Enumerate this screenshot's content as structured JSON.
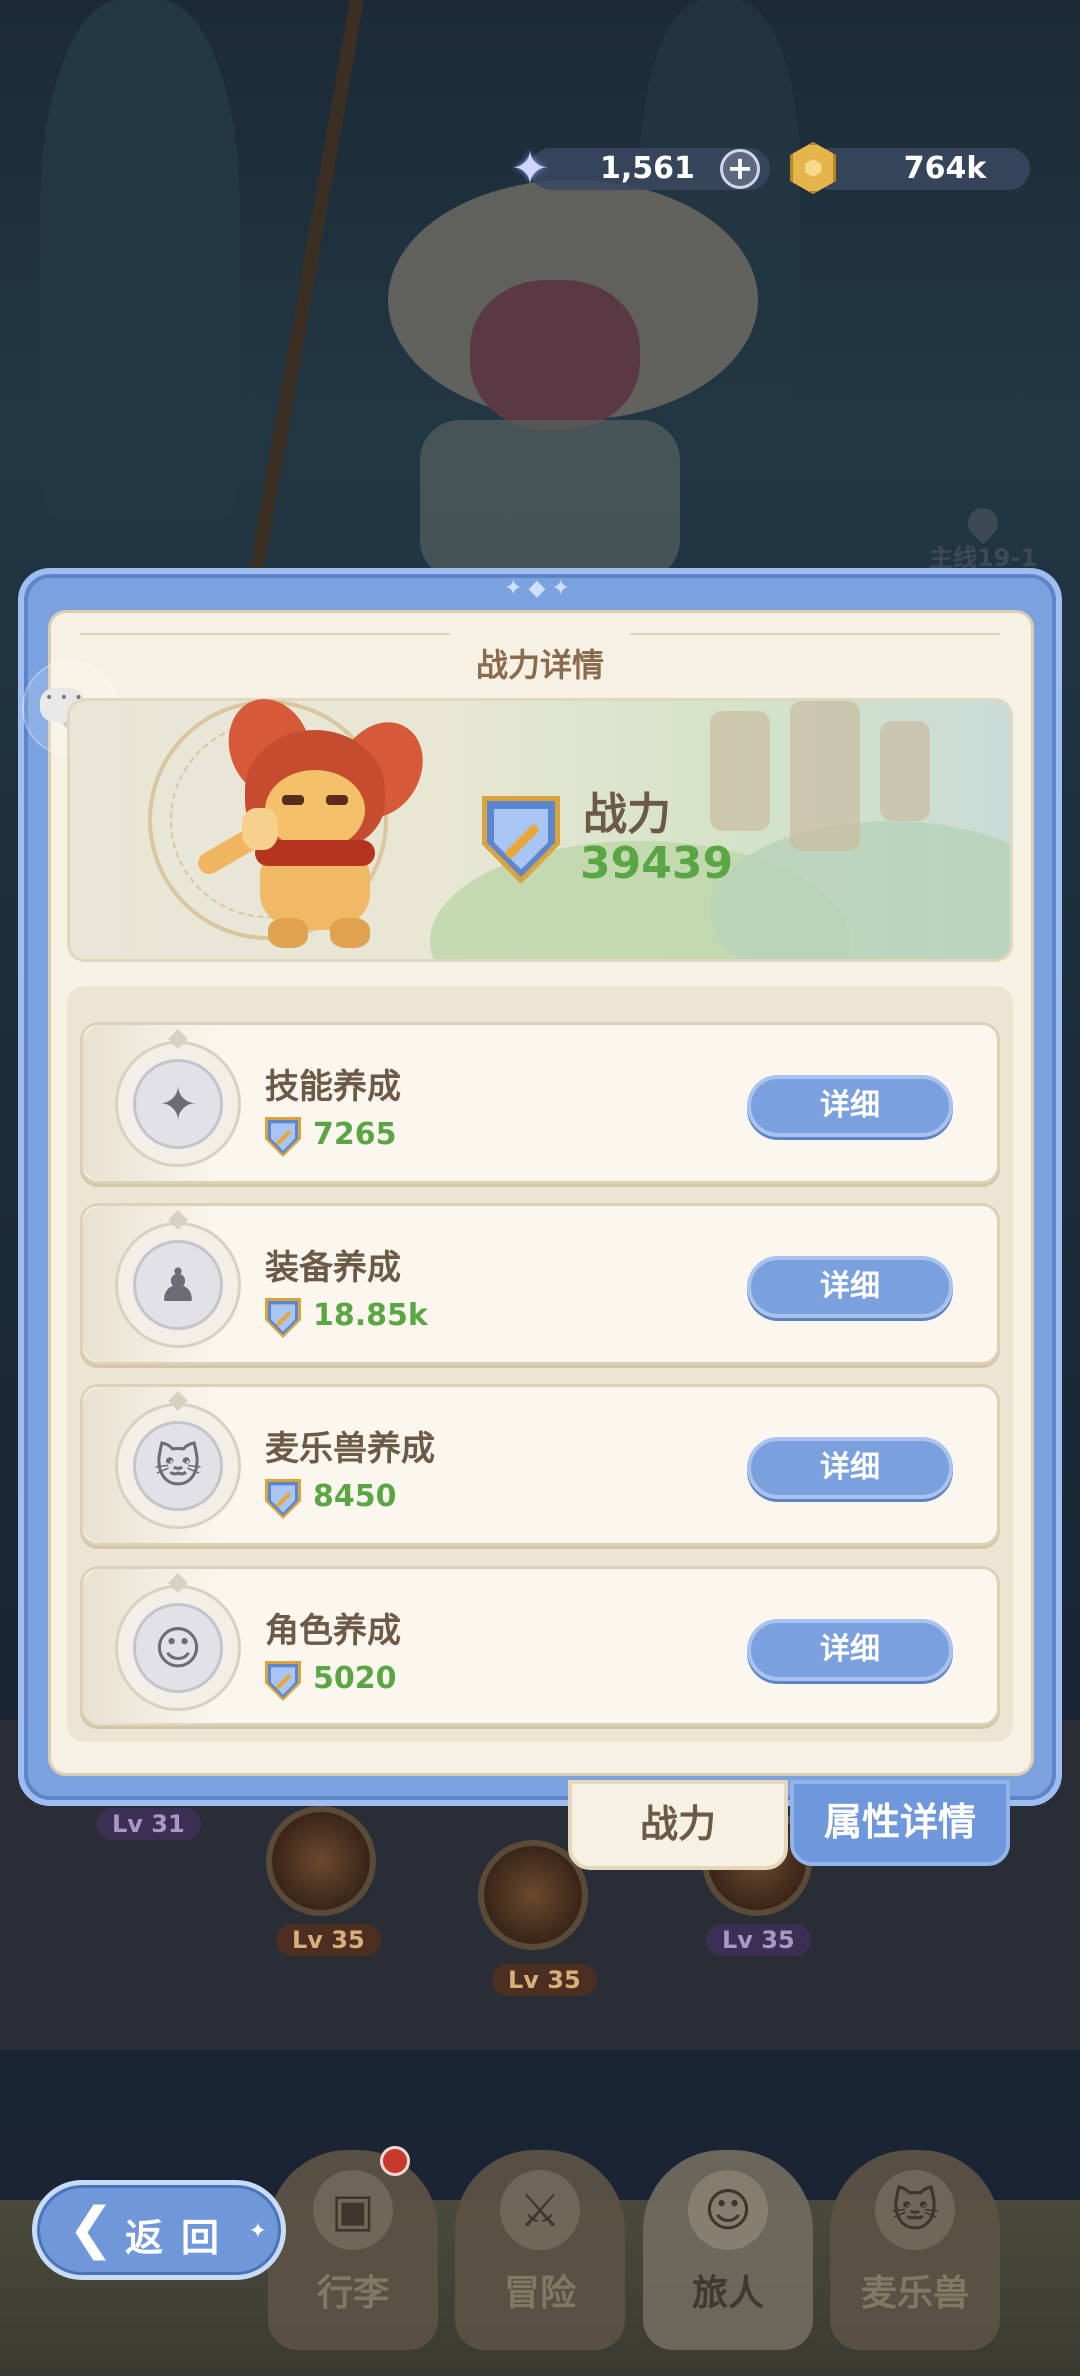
{
  "currency": {
    "gems": {
      "value": "1,561",
      "icon": "star-gem-icon",
      "add_label": "+"
    },
    "gold": {
      "value": "764k",
      "icon": "gold-coin-icon"
    }
  },
  "stage_badge": "主线19-1",
  "panel": {
    "title": "战力详情",
    "power": {
      "label": "战力",
      "value": "39439",
      "icon": "power-shield-icon"
    },
    "rows": [
      {
        "title": "技能养成",
        "value": "7265",
        "button": "详细",
        "icon": "moon-star-icon",
        "glyph": "✦"
      },
      {
        "title": "装备养成",
        "value": "18.85k",
        "button": "详细",
        "icon": "equipment-figure-icon",
        "glyph": "♟"
      },
      {
        "title": "麦乐兽养成",
        "value": "8450",
        "button": "详细",
        "icon": "beast-face-icon",
        "glyph": "🐱"
      },
      {
        "title": "角色养成",
        "value": "5020",
        "button": "详细",
        "icon": "character-hair-icon",
        "glyph": "☺"
      }
    ],
    "tabs": {
      "power": "战力",
      "attributes": "属性详情"
    }
  },
  "background_levels": [
    "Lv 31",
    "Lv 35",
    "Lv 35",
    "Lv 35"
  ],
  "back_button": {
    "label": "返回",
    "icon": "back-arrow-icon"
  },
  "bottom_nav": [
    {
      "label": "行李",
      "icon": "luggage-icon",
      "badge": true
    },
    {
      "label": "冒险",
      "icon": "crossed-swords-icon",
      "badge": false
    },
    {
      "label": "旅人",
      "icon": "traveler-avatar-icon",
      "badge": false,
      "active": true
    },
    {
      "label": "麦乐兽",
      "icon": "beast-icon",
      "badge": false
    }
  ],
  "colors": {
    "accent_blue": "#7aa1de",
    "power_green": "#5aa645",
    "panel_cream": "#f6f1e3",
    "title_brown": "#8a6b4d"
  }
}
